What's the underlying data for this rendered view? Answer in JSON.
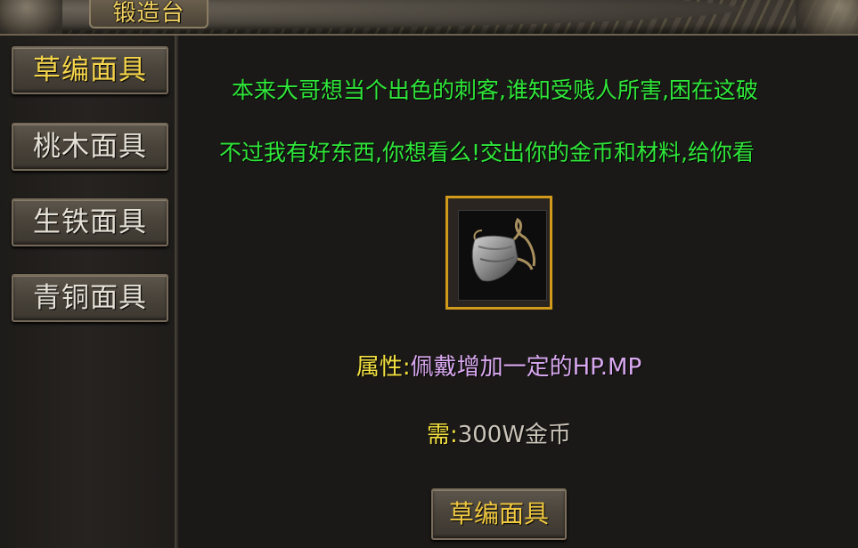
{
  "window": {
    "title": "锻造台"
  },
  "sidebar": {
    "items": [
      {
        "label": "草编面具",
        "active": true
      },
      {
        "label": "桃木面具",
        "active": false
      },
      {
        "label": "生铁面具",
        "active": false
      },
      {
        "label": "青铜面具",
        "active": false
      }
    ]
  },
  "dialog": {
    "line1": "本来大哥想当个出色的刺客,谁知受贱人所害,困在这破",
    "line2": "不过我有好东西,你想看么!交出你的金币和材料,给你看"
  },
  "item": {
    "icon": "cloth-mask-icon",
    "attr_label": "属性:",
    "attr_value": "佩戴增加一定的HP.MP",
    "need_label": "需:",
    "need_value": "300W金币"
  },
  "craft_button": {
    "label": "草编面具"
  },
  "colors": {
    "dialog_text": "#2fe63a",
    "label_yellow": "#f2e040",
    "attr_purple": "#d8a8f0",
    "item_frame": "#d19a1a"
  }
}
